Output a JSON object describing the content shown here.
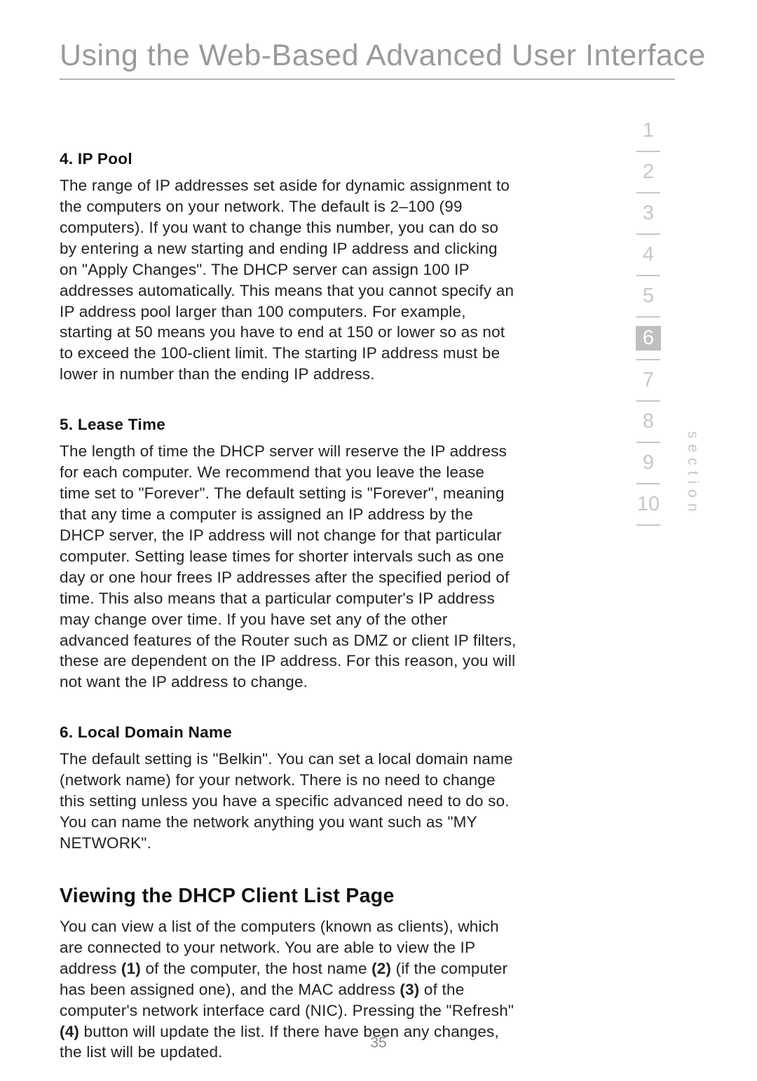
{
  "page": {
    "title": "Using the Web-Based Advanced User Interface",
    "number": "35"
  },
  "sections": {
    "ip_pool": {
      "heading": "4. IP Pool",
      "body": "The range of IP addresses set aside for dynamic assignment to the computers on your network. The default is 2–100 (99 computers). If you want to change this number, you can do so by entering a new starting and ending IP address and clicking on \"Apply Changes\". The DHCP server can assign 100 IP addresses automatically. This means that you cannot specify an IP address pool larger than 100 computers. For example, starting at 50 means you have to end at 150 or lower so as not to exceed the 100-client limit. The starting IP address must be lower in number than the ending IP address."
    },
    "lease_time": {
      "heading": "5. Lease Time",
      "body": "The length of time the DHCP server will reserve the IP address for each computer. We recommend that you leave the lease time set to \"Forever\". The default setting is \"Forever\", meaning that any time a computer is assigned an IP address by the DHCP server, the IP address will not change for that particular computer. Setting lease times for shorter intervals such as one day or one hour frees IP addresses after the specified period of time. This also means that a particular computer's IP address may change over time. If you have set any of the other advanced features of the Router such as DMZ or client IP filters, these are dependent on the IP address. For this reason, you will not want the IP address to change."
    },
    "local_domain": {
      "heading": "6. Local Domain Name",
      "body": "The default setting is \"Belkin\". You can set a local domain name (network name) for your network. There is no need to change this setting unless you have a specific advanced need to do so. You can name the network anything you want such as \"MY NETWORK\"."
    },
    "dhcp_client": {
      "heading": "Viewing the DHCP Client List Page",
      "pre1": "You can view a list of the computers (known as clients), which are connected to your network. You are able to view the IP address ",
      "b1": "(1)",
      "mid1": " of the computer, the host name ",
      "b2": "(2)",
      "mid2": " (if the computer has been assigned one), and the MAC address ",
      "b3": "(3)",
      "mid3": " of the computer's network interface card (NIC). Pressing the \"Refresh\" ",
      "b4": "(4)",
      "post": " button will update the list. If there have been any changes, the list will be updated."
    }
  },
  "nav": {
    "label": "section",
    "items": [
      "1",
      "2",
      "3",
      "4",
      "5",
      "6",
      "7",
      "8",
      "9",
      "10"
    ],
    "active_index": 5
  }
}
